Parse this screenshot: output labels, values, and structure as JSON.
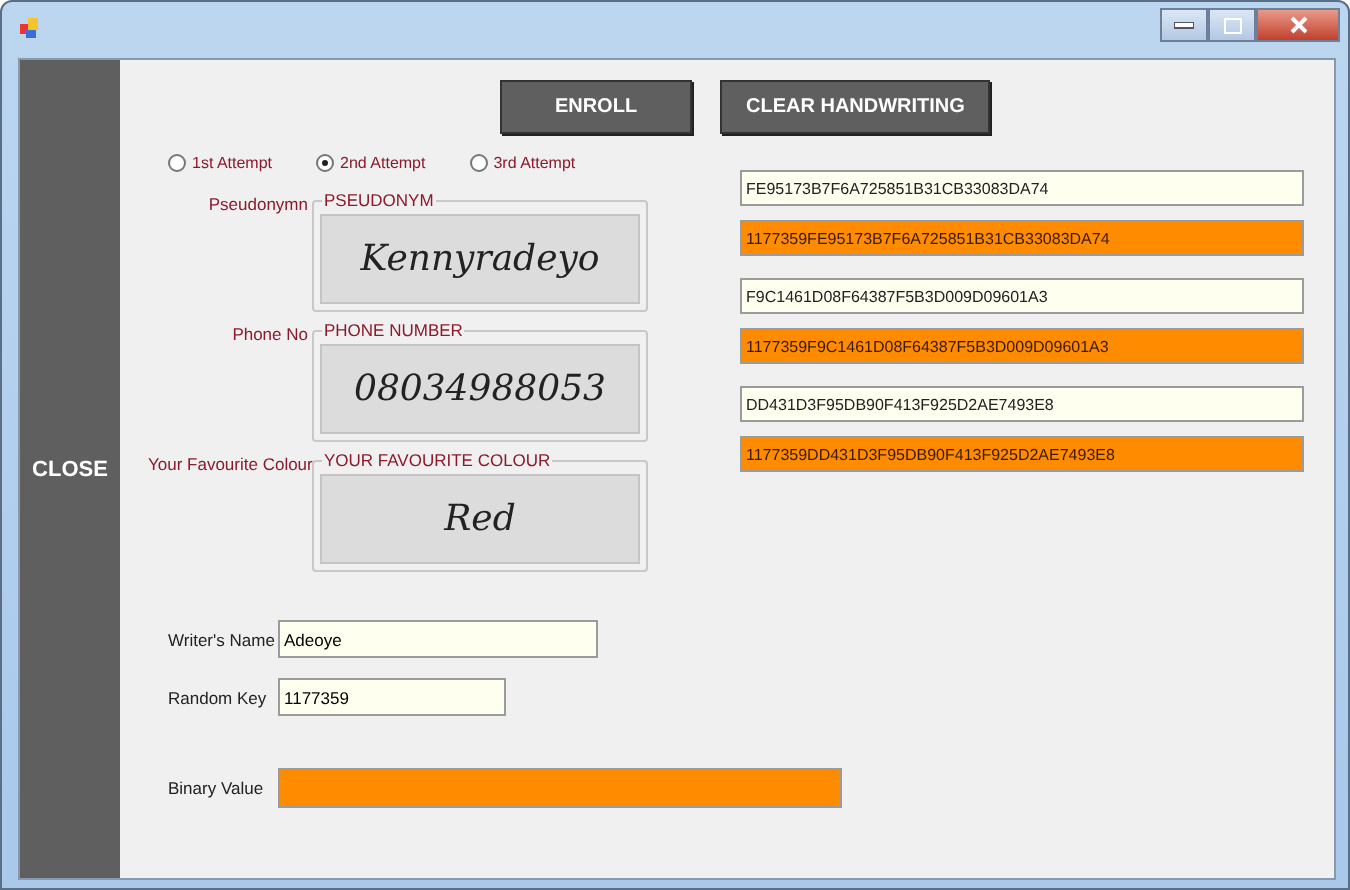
{
  "sidebar": {
    "close_button": "CLOSE"
  },
  "buttons": [
    "ENROLL",
    "CLEAR HANDWRITING"
  ],
  "attempts": [
    {
      "label": "1st Attempt",
      "selected": false
    },
    {
      "label": "2nd Attempt",
      "selected": true
    },
    {
      "label": "3rd Attempt",
      "selected": false
    }
  ],
  "ink_groups": [
    {
      "label": "Pseudonymn",
      "title": "PSEUDONYM",
      "ink": "Kennyradeyo"
    },
    {
      "label": "Phone No",
      "title": "PHONE NUMBER",
      "ink": "08034988053"
    },
    {
      "label": "Your Favourite Colour",
      "title": "YOUR FAVOURITE COLOUR",
      "ink": "Red"
    }
  ],
  "hash_fields": [
    {
      "kind": "plain",
      "value": "FE95173B7F6A725851B31CB33083DA74"
    },
    {
      "kind": "keyed",
      "value": "1177359FE95173B7F6A725851B31CB33083DA74"
    },
    {
      "kind": "plain",
      "value": "F9C1461D08F64387F5B3D009D09601A3"
    },
    {
      "kind": "keyed",
      "value": "1177359F9C1461D08F64387F5B3D009D09601A3"
    },
    {
      "kind": "plain",
      "value": "DD431D3F95DB90F413F925D2AE7493E8"
    },
    {
      "kind": "keyed",
      "value": "1177359DD431D3F95DB90F413F925D2AE7493E8"
    }
  ],
  "writers_name": {
    "label": "Writer's Name",
    "value": "Adeoye"
  },
  "random_key": {
    "label": "Random Key",
    "value": "1177359"
  },
  "binary_value": {
    "label": "Binary Value"
  }
}
